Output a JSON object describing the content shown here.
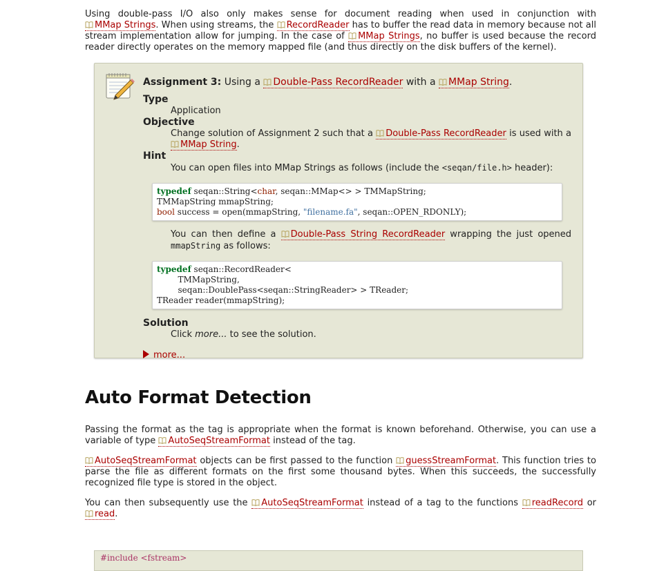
{
  "intro": {
    "text1": "Using double-pass I/O also only makes sense for document reading when used in conjunction with ",
    "link1": "MMap Strings",
    "text2": ". When using streams, the ",
    "link2": "RecordReader",
    "text3": " has to buffer the read data in memory because not all stream implementation allow for jumping. In the case of ",
    "link3": "MMap Strings",
    "text4": ", no buffer is used because the record reader directly operates on the memory mapped file (and thus directly on the disk buffers of the kernel)."
  },
  "assignment": {
    "title_bold": "Assignment 3:",
    "title_text1": " Using a ",
    "title_link1": "Double-Pass RecordReader",
    "title_text2": " with a ",
    "title_link2": "MMap String",
    "title_text3": ".",
    "type_label": "Type",
    "type_value": "Application",
    "objective_label": "Objective",
    "objective_text1": "Change solution of Assignment 2 such that a ",
    "objective_link1": "Double-Pass RecordReader",
    "objective_text2": " is used with a ",
    "objective_link2": "MMap String",
    "objective_text3": ".",
    "hint_label": "Hint",
    "hint_text1": "You can open files into MMap Strings as follows (include the ",
    "hint_code": "<seqan/file.h>",
    "hint_text2": " header):",
    "code1": {
      "l1_kw": "typedef",
      "l1_a": " seqan::String<",
      "l1_ty": "char",
      "l1_b": ", seqan::MMap<> > TMMapString;",
      "l2": "TMMapString mmapString;",
      "l3_ty": "bool",
      "l3_a": " success = open(mmapString, ",
      "l3_st": "\"filename.fa\"",
      "l3_b": ", seqan::OPEN_RDONLY);"
    },
    "hint2_text1": "You can then define a ",
    "hint2_link": "Double-Pass String RecordReader",
    "hint2_text2": " wrapping the just opened ",
    "hint2_code": "mmapString",
    "hint2_text3": " as follows:",
    "code2": {
      "l1_kw": "typedef",
      "l1_a": " seqan::RecordReader<",
      "l2": "        TMMapString,",
      "l3": "        seqan::DoublePass<seqan::StringReader> > TReader;",
      "l4": "TReader reader(mmapString);"
    },
    "solution_label": "Solution",
    "solution_text1": "Click ",
    "solution_em": "more...",
    "solution_text2": " to see the solution.",
    "more_label": "more..."
  },
  "section": {
    "heading": "Auto Format Detection",
    "p1_text1": "Passing the format as the tag is appropriate when the format is known beforehand. Otherwise, you can use a variable of type ",
    "p1_link": "AutoSeqStreamFormat",
    "p1_text2": " instead of the tag.",
    "p2_link1": "AutoSeqStreamFormat",
    "p2_text1": " objects can be first passed to the function ",
    "p2_link2": "guessStreamFormat",
    "p2_text2": ". This function tries to parse the file as different formats on the first some thousand bytes. When this succeeds, the successfully recognized file type is stored in the object.",
    "p3_text1": "You can then subsequently use the ",
    "p3_link1": "AutoSeqStreamFormat",
    "p3_text2": " instead of a tag to the functions ",
    "p3_link2": "readRecord",
    "p3_text3": " or ",
    "p3_link3": "read",
    "p3_text4": ".",
    "code_partial": "#include <fstream>"
  }
}
